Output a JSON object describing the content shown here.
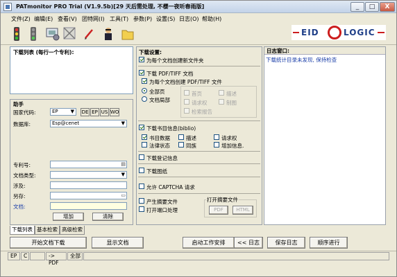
{
  "window": {
    "title": "PATmonitor PRO Trial (V1.9.5b)[29 天后需处理, 不樱一夜听春雨版]",
    "minimize": "_",
    "maximize": "□",
    "close": "X"
  },
  "menu": [
    "文件(Z)",
    "编辑(E)",
    "查看(V)",
    "团特网(I)",
    "工具(T)",
    "参数(P)",
    "设置(S)",
    "日志(O)",
    "帮助(H)"
  ],
  "logo": {
    "left": "EID",
    "right": "LOGIC"
  },
  "patent_list": {
    "header": "下载列表 (每行一个专利):"
  },
  "helper": {
    "title": "助手",
    "country_label": "国家代码:",
    "country_value": "EP",
    "country_buttons": [
      "DE",
      "EP",
      "US",
      "WO"
    ],
    "database_label": "数据库:",
    "database_value": "Esp@cenet",
    "patent_no_label": "专利号:",
    "doc_type_label": "文档类型:",
    "involve_label": "涉及:",
    "save_as_label": "另存:",
    "document_label": "文档:",
    "add_button": "增加",
    "clear_button": "清除"
  },
  "download_settings": {
    "title": "下载设置:",
    "per_doc_folder": "为每个文档创建新文件夹",
    "download_pdf": "下载 PDF/TIFF 文档",
    "per_doc_pdf": "为每个文档创建 PDF/TIFF 文件",
    "all_pages": "全部页",
    "partial_pages": "文档局部",
    "page_opts": [
      "首页",
      "描述",
      "请求权",
      "制图",
      "检索报告"
    ],
    "download_biblio": "下载书目信息(biblio)",
    "biblio_opts": [
      "书目数据",
      "描述",
      "请求权",
      "法律状态",
      "同族",
      "增加信息."
    ],
    "download_register": "下载登记信息",
    "download_drawings": "下载图纸",
    "allow_captcha": "允许 CAPTCHA 请求",
    "generate_abstract": "产生摘要文件",
    "open_port": "打开端口处理",
    "abstract_group": "打开摘要文件",
    "pdf_btn": "PDF",
    "html_btn": "HTML"
  },
  "log": {
    "title": "日志窗口:",
    "line": "下载统计目录未发现, 保持检查"
  },
  "tabs": [
    "下载列表",
    "基本检索",
    "高级检索"
  ],
  "buttons": {
    "start": "开始文档下载",
    "show": "显示文档",
    "schedule": "启动工作安排",
    "log": "<< 日志",
    "save_log": "保存日志",
    "sequence": "顺序进行"
  },
  "status": [
    "EP",
    "C",
    "",
    "-> PDF",
    "全部"
  ]
}
